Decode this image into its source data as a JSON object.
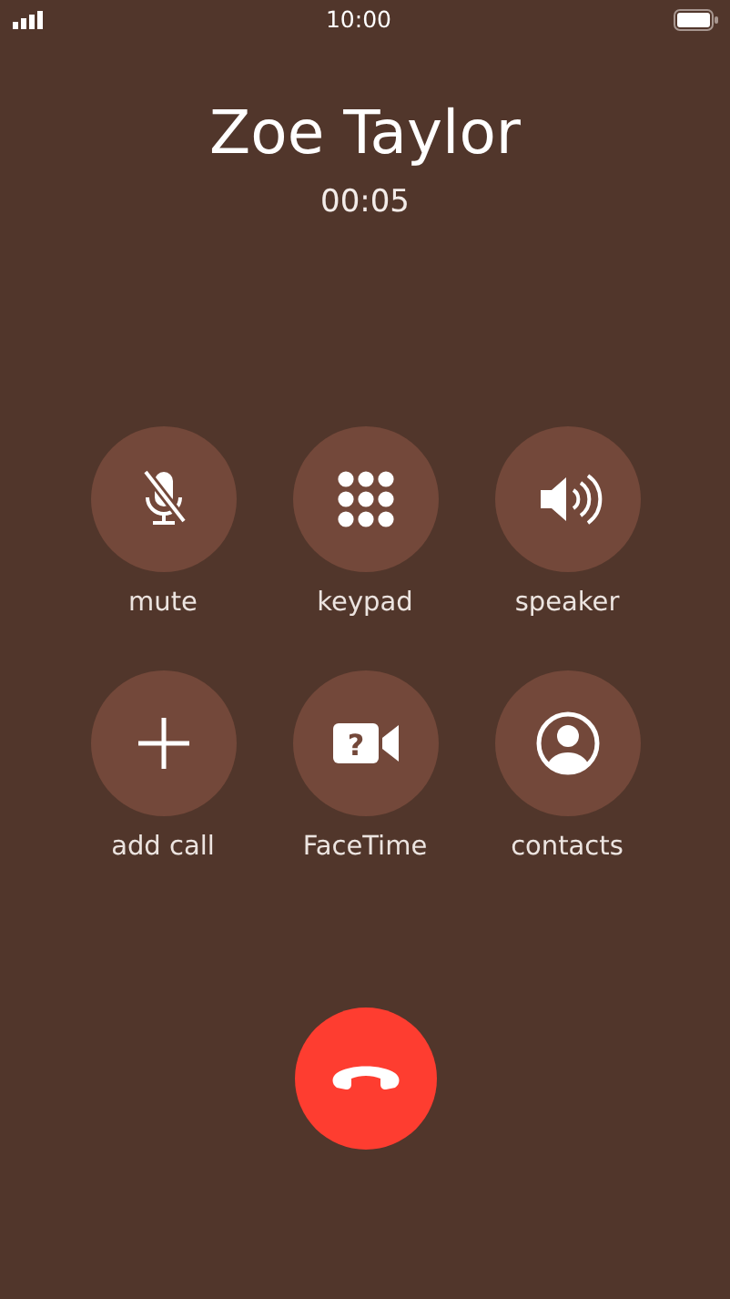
{
  "status_bar": {
    "time": "10:00"
  },
  "caller": {
    "name": "Zoe Taylor",
    "duration": "00:05"
  },
  "buttons": [
    {
      "kind": "mute",
      "label": "mute"
    },
    {
      "kind": "keypad",
      "label": "keypad"
    },
    {
      "kind": "speaker",
      "label": "speaker"
    },
    {
      "kind": "add",
      "label": "add call"
    },
    {
      "kind": "video",
      "label": "FaceTime",
      "glyph": "?"
    },
    {
      "kind": "contact",
      "label": "contacts"
    }
  ]
}
